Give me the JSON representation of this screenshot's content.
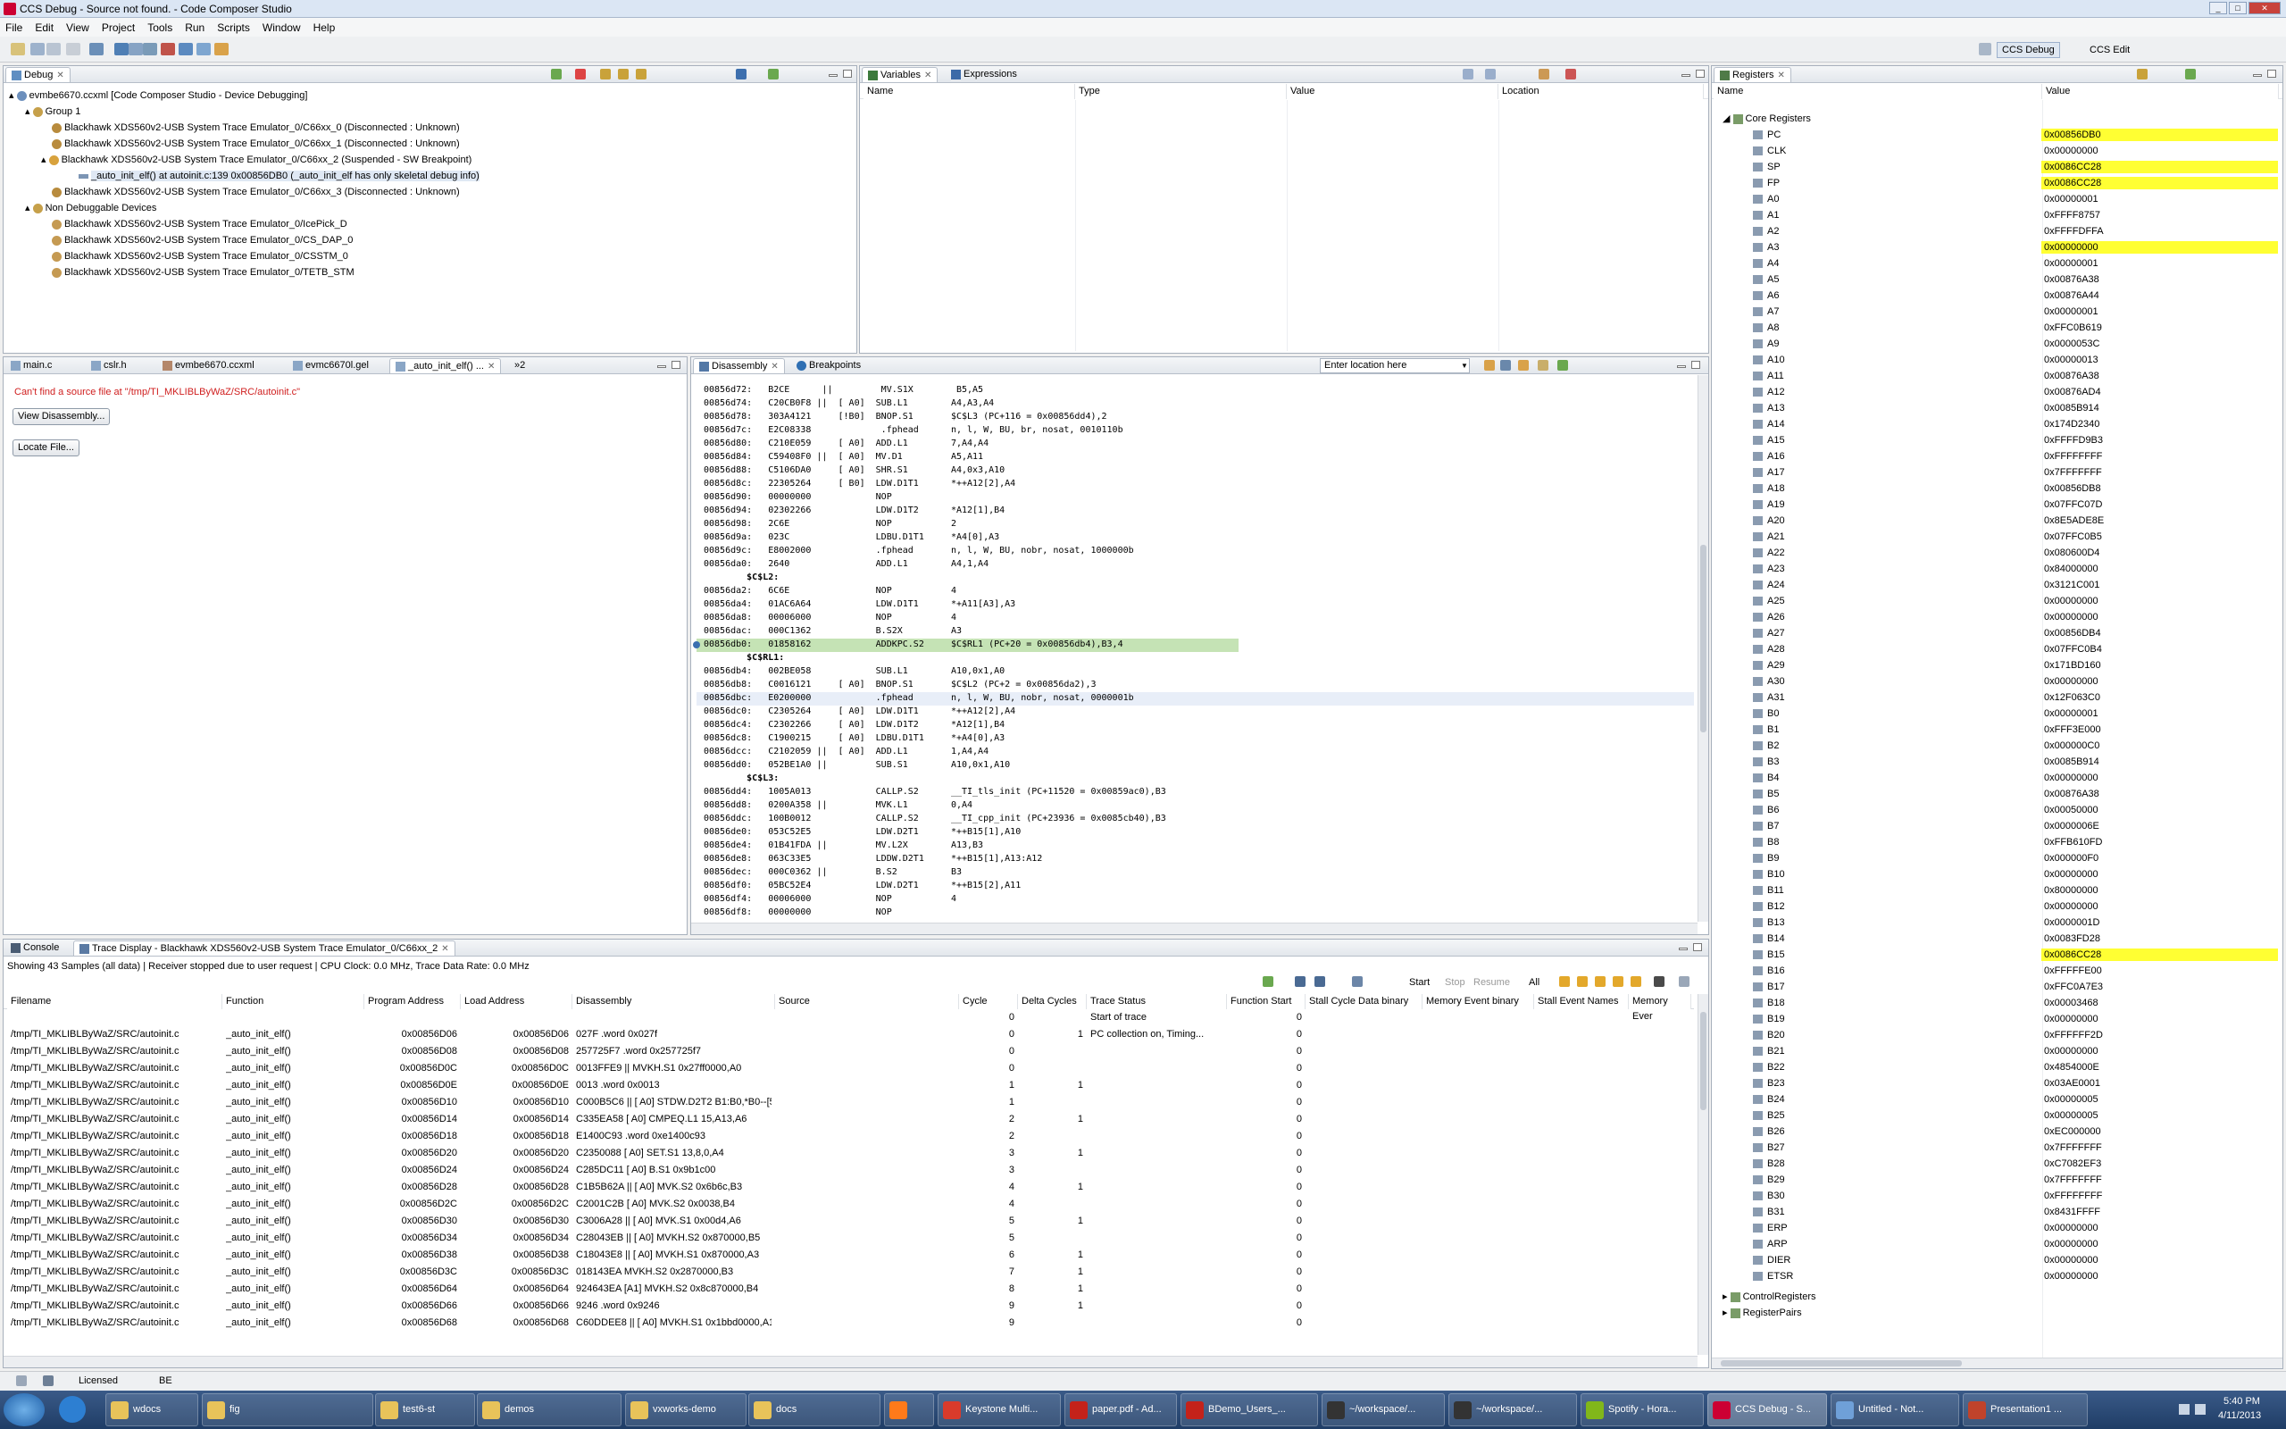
{
  "window": {
    "title": "CCS Debug - Source not found. - Code Composer Studio"
  },
  "menu": [
    "File",
    "Edit",
    "View",
    "Project",
    "Tools",
    "Run",
    "Scripts",
    "Window",
    "Help"
  ],
  "perspectives": {
    "debug": "CCS Debug",
    "edit": "CCS Edit"
  },
  "debug_view": {
    "tab": "Debug",
    "root": "evmbe6670.ccxml [Code Composer Studio - Device Debugging]",
    "group": "Group 1",
    "items": [
      "Blackhawk XDS560v2-USB System Trace Emulator_0/C66xx_0 (Disconnected : Unknown)",
      "Blackhawk XDS560v2-USB System Trace Emulator_0/C66xx_1 (Disconnected : Unknown)",
      "Blackhawk XDS560v2-USB System Trace Emulator_0/C66xx_2 (Suspended - SW Breakpoint)"
    ],
    "frame": "_auto_init_elf() at autoinit.c:139 0x00856DB0  (_auto_init_elf has only skeletal debug info)",
    "item3": "Blackhawk XDS560v2-USB System Trace Emulator_0/C66xx_3 (Disconnected : Unknown)",
    "non_debuggable": "Non Debuggable Devices",
    "non_items": [
      "Blackhawk XDS560v2-USB System Trace Emulator_0/IcePick_D",
      "Blackhawk XDS560v2-USB System Trace Emulator_0/CS_DAP_0",
      "Blackhawk XDS560v2-USB System Trace Emulator_0/CSSTM_0",
      "Blackhawk XDS560v2-USB System Trace Emulator_0/TETB_STM"
    ]
  },
  "variables_view": {
    "tab1": "Variables",
    "tab2": "Expressions",
    "cols": [
      "Name",
      "Type",
      "Value",
      "Location"
    ]
  },
  "registers_view": {
    "tab": "Registers",
    "cols": [
      "Name",
      "Value"
    ],
    "group": "Core Registers",
    "regs": [
      [
        "PC",
        "0x00856DB0",
        true
      ],
      [
        "CLK",
        "0x00000000",
        false
      ],
      [
        "SP",
        "0x0086CC28",
        true
      ],
      [
        "FP",
        "0x0086CC28",
        true
      ],
      [
        "A0",
        "0x00000001",
        false
      ],
      [
        "A1",
        "0xFFFF8757",
        false
      ],
      [
        "A2",
        "0xFFFFDFFA",
        false
      ],
      [
        "A3",
        "0x00000000",
        true
      ],
      [
        "A4",
        "0x00000001",
        false
      ],
      [
        "A5",
        "0x00876A38",
        false
      ],
      [
        "A6",
        "0x00876A44",
        false
      ],
      [
        "A7",
        "0x00000001",
        false
      ],
      [
        "A8",
        "0xFFC0B619",
        false
      ],
      [
        "A9",
        "0x0000053C",
        false
      ],
      [
        "A10",
        "0x00000013",
        false
      ],
      [
        "A11",
        "0x00876A38",
        false
      ],
      [
        "A12",
        "0x00876AD4",
        false
      ],
      [
        "A13",
        "0x0085B914",
        false
      ],
      [
        "A14",
        "0x174D2340",
        false
      ],
      [
        "A15",
        "0xFFFFD9B3",
        false
      ],
      [
        "A16",
        "0xFFFFFFFF",
        false
      ],
      [
        "A17",
        "0x7FFFFFFF",
        false
      ],
      [
        "A18",
        "0x00856DB8",
        false
      ],
      [
        "A19",
        "0x07FFC07D",
        false
      ],
      [
        "A20",
        "0x8E5ADE8E",
        false
      ],
      [
        "A21",
        "0x07FFC0B5",
        false
      ],
      [
        "A22",
        "0x080600D4",
        false
      ],
      [
        "A23",
        "0x84000000",
        false
      ],
      [
        "A24",
        "0x3121C001",
        false
      ],
      [
        "A25",
        "0x00000000",
        false
      ],
      [
        "A26",
        "0x00000000",
        false
      ],
      [
        "A27",
        "0x00856DB4",
        false
      ],
      [
        "A28",
        "0x07FFC0B4",
        false
      ],
      [
        "A29",
        "0x171BD160",
        false
      ],
      [
        "A30",
        "0x00000000",
        false
      ],
      [
        "A31",
        "0x12F063C0",
        false
      ],
      [
        "B0",
        "0x00000001",
        false
      ],
      [
        "B1",
        "0xFFF3E000",
        false
      ],
      [
        "B2",
        "0x000000C0",
        false
      ],
      [
        "B3",
        "0x0085B914",
        false
      ],
      [
        "B4",
        "0x00000000",
        false
      ],
      [
        "B5",
        "0x00876A38",
        false
      ],
      [
        "B6",
        "0x00050000",
        false
      ],
      [
        "B7",
        "0x0000006E",
        false
      ],
      [
        "B8",
        "0xFFB610FD",
        false
      ],
      [
        "B9",
        "0x000000F0",
        false
      ],
      [
        "B10",
        "0x00000000",
        false
      ],
      [
        "B11",
        "0x80000000",
        false
      ],
      [
        "B12",
        "0x00000000",
        false
      ],
      [
        "B13",
        "0x0000001D",
        false
      ],
      [
        "B14",
        "0x0083FD28",
        false
      ],
      [
        "B15",
        "0x0086CC28",
        true
      ],
      [
        "B16",
        "0xFFFFFE00",
        false
      ],
      [
        "B17",
        "0xFFC0A7E3",
        false
      ],
      [
        "B18",
        "0x00003468",
        false
      ],
      [
        "B19",
        "0x00000000",
        false
      ],
      [
        "B20",
        "0xFFFFFF2D",
        false
      ],
      [
        "B21",
        "0x00000000",
        false
      ],
      [
        "B22",
        "0x4854000E",
        false
      ],
      [
        "B23",
        "0x03AE0001",
        false
      ],
      [
        "B24",
        "0x00000005",
        false
      ],
      [
        "B25",
        "0x00000005",
        false
      ],
      [
        "B26",
        "0xEC000000",
        false
      ],
      [
        "B27",
        "0x7FFFFFFF",
        false
      ],
      [
        "B28",
        "0xC7082EF3",
        false
      ],
      [
        "B29",
        "0x7FFFFFFF",
        false
      ],
      [
        "B30",
        "0xFFFFFFFF",
        false
      ],
      [
        "B31",
        "0x8431FFFF",
        false
      ],
      [
        "ERP",
        "0x00000000",
        false
      ],
      [
        "ARP",
        "0x00000000",
        false
      ],
      [
        "DIER",
        "0x00000000",
        false
      ],
      [
        "ETSR",
        "0x00000000",
        false
      ]
    ],
    "group2": "ControlRegisters",
    "group3": "RegisterPairs"
  },
  "editor_tabs": [
    "main.c",
    "cslr.h",
    "evmbe6670.ccxml",
    "evmc6670l.gel",
    "_auto_init_elf() ..."
  ],
  "source_not_found": {
    "msg": "Can't find a source file at \"/tmp/TI_MKLIBLByWaZ/SRC/autoinit.c\"",
    "btn1": "View Disassembly...",
    "btn2": "Locate File..."
  },
  "disasm_view": {
    "tab1": "Disassembly",
    "tab2": "Breakpoints",
    "location_placeholder": "Enter location here",
    "lines": [
      {
        "t": "00856d72:   B2CE      ||         MV.S1X        B5,A5",
        "k": "n"
      },
      {
        "t": "00856d74:   C20CB0F8 ||  [ A0]  SUB.L1        A4,A3,A4",
        "k": "n"
      },
      {
        "t": "00856d78:   303A4121     [!B0]  BNOP.S1       $C$L3 (PC+116 = 0x00856dd4),2",
        "k": "n"
      },
      {
        "t": "00856d7c:   E2C08338             .fphead      n, l, W, BU, br, nosat, 0010110b",
        "k": "n"
      },
      {
        "t": "00856d80:   C210E059     [ A0]  ADD.L1        7,A4,A4",
        "k": "n"
      },
      {
        "t": "00856d84:   C59408F0 ||  [ A0]  MV.D1         A5,A11",
        "k": "n"
      },
      {
        "t": "00856d88:   C5106DA0     [ A0]  SHR.S1        A4,0x3,A10",
        "k": "n"
      },
      {
        "t": "00856d8c:   22305264     [ B0]  LDW.D1T1      *++A12[2],A4",
        "k": "n"
      },
      {
        "t": "00856d90:   00000000            NOP",
        "k": "n"
      },
      {
        "t": "00856d94:   02302266            LDW.D1T2      *A12[1],B4",
        "k": "n"
      },
      {
        "t": "00856d98:   2C6E                NOP           2",
        "k": "n"
      },
      {
        "t": "00856d9a:   023C                LDBU.D1T1     *A4[0],A3",
        "k": "n"
      },
      {
        "t": "00856d9c:   E8002000            .fphead       n, l, W, BU, nobr, nosat, 1000000b",
        "k": "n"
      },
      {
        "t": "00856da0:   2640                ADD.L1        A4,1,A4",
        "k": "n"
      },
      {
        "t": "        $C$L2:",
        "k": "l"
      },
      {
        "t": "00856da2:   6C6E                NOP           4",
        "k": "n"
      },
      {
        "t": "00856da4:   01AC6A64            LDW.D1T1      *+A11[A3],A3",
        "k": "n"
      },
      {
        "t": "00856da8:   00006000            NOP           4",
        "k": "n"
      },
      {
        "t": "00856dac:   000C1362            B.S2X         A3",
        "k": "n"
      },
      {
        "t": "00856db0:   01858162            ADDKPC.S2     $C$RL1 (PC+20 = 0x00856db4),B3,4",
        "k": "pc"
      },
      {
        "t": "        $C$RL1:",
        "k": "l"
      },
      {
        "t": "00856db4:   002BE058            SUB.L1        A10,0x1,A0",
        "k": "n"
      },
      {
        "t": "00856db8:   C0016121     [ A0]  BNOP.S1       $C$L2 (PC+2 = 0x00856da2),3",
        "k": "n"
      },
      {
        "t": "00856dbc:   E0200000            .fphead       n, l, W, BU, nobr, nosat, 0000001b",
        "k": "sel"
      },
      {
        "t": "00856dc0:   C2305264     [ A0]  LDW.D1T1      *++A12[2],A4",
        "k": "n"
      },
      {
        "t": "00856dc4:   C2302266     [ A0]  LDW.D1T2      *A12[1],B4",
        "k": "n"
      },
      {
        "t": "00856dc8:   C1900215     [ A0]  LDBU.D1T1     *+A4[0],A3",
        "k": "n"
      },
      {
        "t": "00856dcc:   C2102059 ||  [ A0]  ADD.L1        1,A4,A4",
        "k": "n"
      },
      {
        "t": "00856dd0:   052BE1A0 ||         SUB.S1        A10,0x1,A10",
        "k": "n"
      },
      {
        "t": "        $C$L3:",
        "k": "l"
      },
      {
        "t": "00856dd4:   1005A013            CALLP.S2      __TI_tls_init (PC+11520 = 0x00859ac0),B3",
        "k": "n"
      },
      {
        "t": "00856dd8:   0200A358 ||         MVK.L1        0,A4",
        "k": "n"
      },
      {
        "t": "00856ddc:   100B0012            CALLP.S2      __TI_cpp_init (PC+23936 = 0x0085cb40),B3",
        "k": "n"
      },
      {
        "t": "00856de0:   053C52E5            LDW.D2T1      *++B15[1],A10",
        "k": "n"
      },
      {
        "t": "00856de4:   01B41FDA ||         MV.L2X        A13,B3",
        "k": "n"
      },
      {
        "t": "00856de8:   063C33E5            LDDW.D2T1     *++B15[1],A13:A12",
        "k": "n"
      },
      {
        "t": "00856dec:   000C0362 ||         B.S2          B3",
        "k": "n"
      },
      {
        "t": "00856df0:   05BC52E4            LDW.D2T1      *++B15[2],A11",
        "k": "n"
      },
      {
        "t": "00856df4:   00006000            NOP           4",
        "k": "n"
      },
      {
        "t": "00856df8:   00000000            NOP",
        "k": "n"
      }
    ]
  },
  "trace_view": {
    "tab1": "Console",
    "tab2": "Trace Display - Blackhawk XDS560v2-USB System Trace Emulator_0/C66xx_2",
    "info": "Showing 43 Samples (all data)  |  Receiver stopped due to user request  |  CPU Clock: 0.0 MHz, Trace Data Rate: 0.0 MHz",
    "buttons": {
      "start": "Start",
      "stop": "Stop",
      "resume": "Resume",
      "all": "All"
    },
    "cols": [
      "Filename",
      "Function",
      "Program Address",
      "Load Address",
      "Disassembly",
      "Source",
      "Cycle",
      "Delta Cycles",
      "Trace Status",
      "Function Start",
      "Stall Cycle Data binary",
      "Memory Event binary",
      "Stall Event Names",
      "Memory Ever"
    ],
    "rows": [
      [
        "",
        "",
        "",
        "",
        "",
        "",
        "0",
        "",
        "Start of trace",
        "0"
      ],
      [
        "/tmp/TI_MKLIBLByWaZ/SRC/autoinit.c",
        "_auto_init_elf()",
        "0x00856D06",
        "0x00856D06",
        "027F .word  0x027f",
        "",
        "0",
        "1",
        "PC collection on, Timing...",
        "0"
      ],
      [
        "/tmp/TI_MKLIBLByWaZ/SRC/autoinit.c",
        "_auto_init_elf()",
        "0x00856D08",
        "0x00856D08",
        "257725F7       .word      0x257725f7",
        "",
        "0",
        "",
        "",
        "0"
      ],
      [
        "/tmp/TI_MKLIBLByWaZ/SRC/autoinit.c",
        "_auto_init_elf()",
        "0x00856D0C",
        "0x00856D0C",
        "0013FFE9 ||          MVKH.S1     0x27ff0000,A0",
        "",
        "0",
        "",
        "",
        "0"
      ],
      [
        "/tmp/TI_MKLIBLByWaZ/SRC/autoinit.c",
        "_auto_init_elf()",
        "0x00856D0E",
        "0x00856D0E",
        "0013 .word  0x0013",
        "",
        "1",
        "1",
        "",
        "0"
      ],
      [
        "/tmp/TI_MKLIBLByWaZ/SRC/autoinit.c",
        "_auto_init_elf()",
        "0x00856D10",
        "0x00856D10",
        "C000B5C6 || [ A0] STDW.D2T2    B1:B0,*B0--[5]",
        "",
        "1",
        "",
        "",
        "0"
      ],
      [
        "/tmp/TI_MKLIBLByWaZ/SRC/autoinit.c",
        "_auto_init_elf()",
        "0x00856D14",
        "0x00856D14",
        "C335EA58  [ A0]  CMPEQ.L1     15,A13,A6",
        "",
        "2",
        "1",
        "",
        "0"
      ],
      [
        "/tmp/TI_MKLIBLByWaZ/SRC/autoinit.c",
        "_auto_init_elf()",
        "0x00856D18",
        "0x00856D18",
        "E1400C93          .word      0xe1400c93",
        "",
        "2",
        "",
        "",
        "0"
      ],
      [
        "/tmp/TI_MKLIBLByWaZ/SRC/autoinit.c",
        "_auto_init_elf()",
        "0x00856D20",
        "0x00856D20",
        "C2350088  [ A0]  SET.S1       13,8,0,A4",
        "",
        "3",
        "1",
        "",
        "0"
      ],
      [
        "/tmp/TI_MKLIBLByWaZ/SRC/autoinit.c",
        "_auto_init_elf()",
        "0x00856D24",
        "0x00856D24",
        "C285DC11  [ A0]  B.S1         0x9b1c00",
        "",
        "3",
        "",
        "",
        "0"
      ],
      [
        "/tmp/TI_MKLIBLByWaZ/SRC/autoinit.c",
        "_auto_init_elf()",
        "0x00856D28",
        "0x00856D28",
        "C1B5B62A || [ A0]  MVK.S2      0x6b6c,B3",
        "",
        "4",
        "1",
        "",
        "0"
      ],
      [
        "/tmp/TI_MKLIBLByWaZ/SRC/autoinit.c",
        "_auto_init_elf()",
        "0x00856D2C",
        "0x00856D2C",
        "C2001C2B  [ A0]  MVK.S2       0x0038,B4",
        "",
        "4",
        "",
        "",
        "0"
      ],
      [
        "/tmp/TI_MKLIBLByWaZ/SRC/autoinit.c",
        "_auto_init_elf()",
        "0x00856D30",
        "0x00856D30",
        "C3006A28 || [ A0]  MVK.S1      0x00d4,A6",
        "",
        "5",
        "1",
        "",
        "0"
      ],
      [
        "/tmp/TI_MKLIBLByWaZ/SRC/autoinit.c",
        "_auto_init_elf()",
        "0x00856D34",
        "0x00856D34",
        "C28043EB || [ A0]  MVKH.S2     0x870000,B5",
        "",
        "5",
        "",
        "",
        "0"
      ],
      [
        "/tmp/TI_MKLIBLByWaZ/SRC/autoinit.c",
        "_auto_init_elf()",
        "0x00856D38",
        "0x00856D38",
        "C18043E8 || [ A0]  MVKH.S1     0x870000,A3",
        "",
        "6",
        "1",
        "",
        "0"
      ],
      [
        "/tmp/TI_MKLIBLByWaZ/SRC/autoinit.c",
        "_auto_init_elf()",
        "0x00856D3C",
        "0x00856D3C",
        "018143EA      MVKH.S2        0x2870000,B3",
        "",
        "7",
        "1",
        "",
        "0"
      ],
      [
        "/tmp/TI_MKLIBLByWaZ/SRC/autoinit.c",
        "_auto_init_elf()",
        "0x00856D64",
        "0x00856D64",
        "924643EA  [A1]  MVKH.S2       0x8c870000,B4",
        "",
        "8",
        "1",
        "",
        "0"
      ],
      [
        "/tmp/TI_MKLIBLByWaZ/SRC/autoinit.c",
        "_auto_init_elf()",
        "0x00856D66",
        "0x00856D66",
        "9246 .word  0x9246",
        "",
        "9",
        "1",
        "",
        "0"
      ],
      [
        "/tmp/TI_MKLIBLByWaZ/SRC/autoinit.c",
        "_auto_init_elf()",
        "0x00856D68",
        "0x00856D68",
        "C60DDEE8 || [ A0]  MVKH.S1     0x1bbd0000,A12",
        "",
        "9",
        "",
        "",
        "0"
      ]
    ]
  },
  "status": {
    "licensed": "Licensed",
    "be": "BE"
  },
  "taskbar": {
    "items": [
      "wdocs",
      "fig",
      "test6-st",
      "demos",
      "vxworks-demo",
      "docs",
      "",
      "Keystone Multi...",
      "paper.pdf - Ad...",
      "BDemo_Users_...",
      "~/workspace/...",
      "~/workspace/...",
      "Spotify - Hora...",
      "CCS Debug - S...",
      "Untitled - Not...",
      "Presentation1 ..."
    ],
    "time": "5:40 PM",
    "date": "4/11/2013"
  }
}
